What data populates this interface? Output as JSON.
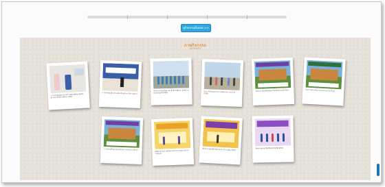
{
  "more_button": {
    "label": "ดูกิจกรรมทั้งหมด >>"
  },
  "gallery": {
    "title": "ภาพกิจกรรม",
    "subtitle": "ACTIVITY"
  },
  "photos": [
    {
      "caption": "การประชุมคณะกรรมการสถานศึกษาขั้นพื้นฐานประจำปีการศึกษา 2565",
      "theme": "office"
    },
    {
      "caption": "การประชุมผู้ปกครองนักเรียนประจำปีการศึกษา",
      "theme": "banner-stage"
    },
    {
      "caption": "กิจกรรมวันไหว้ครู ประจำปีการศึกษา 2565 ณ หอประชุมโรงเรียน",
      "theme": "group-outdoor"
    },
    {
      "caption": "กิจกรรมวันต่อต้านยาเสพติดโลก ประจำปี 2565",
      "theme": "crowd-outdoor"
    },
    {
      "caption": "โครงการส่งเสริมคุณธรรมจริยธรรมนักเรียน",
      "theme": "poster-school"
    },
    {
      "caption": "กิจกรรมส่งเสริมการอ่านและการเรียนรู้",
      "theme": "poster-school"
    },
    {
      "caption": "การอบรมพัฒนาครูและบุคลากรทางการศึกษา",
      "theme": "poster-school"
    },
    {
      "caption": "MOU ความร่วมมือทางวิชาการกับหน่วยงานภายนอก",
      "theme": "mou"
    },
    {
      "caption": "พิธีลงนามบันทึกข้อตกลงความร่วมมือ MOU",
      "theme": "mou"
    },
    {
      "caption": "กิจกรรมมอบเกียรติบัตรนักเรียนดีเด่น",
      "theme": "ceremony"
    }
  ]
}
